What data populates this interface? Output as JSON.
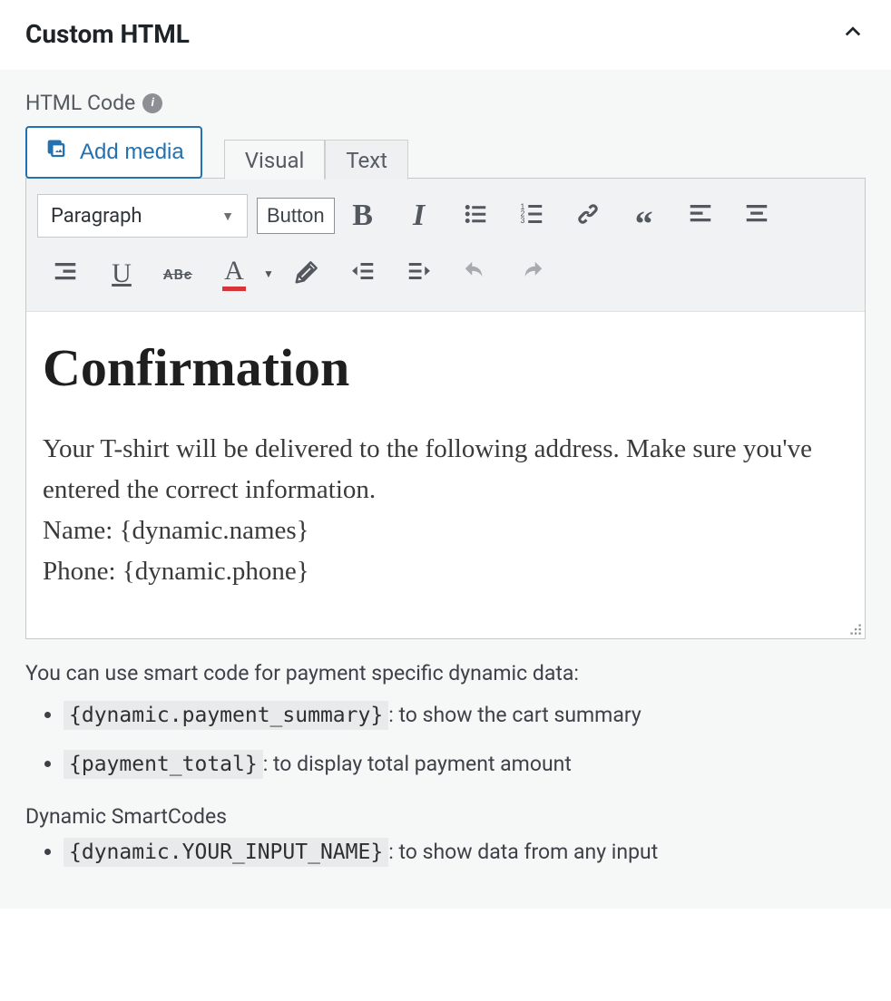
{
  "panel": {
    "title": "Custom HTML"
  },
  "field": {
    "label": "HTML Code"
  },
  "buttons": {
    "add_media": "Add media",
    "button_label": "Button"
  },
  "tabs": {
    "visual": "Visual",
    "text": "Text",
    "active": "visual"
  },
  "format_select": {
    "value": "Paragraph"
  },
  "editor_content": {
    "heading": "Confirmation",
    "line1": "Your T-shirt will be delivered to the following address. Make sure you've entered the correct information.",
    "line2": "Name: {dynamic.names}",
    "line3": "Phone: {dynamic.phone}"
  },
  "help": {
    "intro": "You can use smart code for payment specific dynamic data:",
    "items": [
      {
        "code": "{dynamic.payment_summary}",
        "desc": ": to show the cart summary"
      },
      {
        "code": "{payment_total}",
        "desc": ": to display total payment amount"
      }
    ],
    "subhead": "Dynamic SmartCodes",
    "items2": [
      {
        "code": "{dynamic.YOUR_INPUT_NAME}",
        "desc": ": to show data from any input"
      }
    ]
  },
  "icons": {
    "media": "media-icon",
    "info": "info-icon",
    "bold": "bold-icon",
    "italic": "italic-icon",
    "ul": "unordered-list-icon",
    "ol": "ordered-list-icon",
    "link": "link-icon",
    "quote": "blockquote-icon",
    "alignleft": "align-left-icon",
    "aligncenter": "align-center-icon",
    "alignedge": "align-edge-icon",
    "underline": "underline-icon",
    "strike": "strikethrough-icon",
    "textcolor": "text-color-icon",
    "clear": "clear-format-icon",
    "outdent": "outdent-icon",
    "indent": "indent-icon",
    "undo": "undo-icon",
    "redo": "redo-icon",
    "chevron": "chevron-up-icon",
    "grip": "resize-grip-icon"
  }
}
